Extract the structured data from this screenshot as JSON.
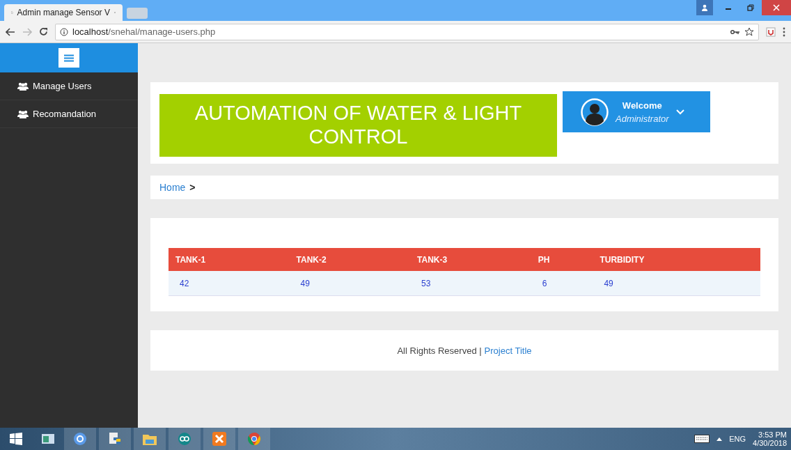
{
  "browser": {
    "tab_title": "Admin manage Sensor V",
    "url_host": "localhost",
    "url_path": "/snehal/manage-users.php"
  },
  "sidebar": {
    "items": [
      {
        "label": "Manage Users"
      },
      {
        "label": "Recomandation"
      }
    ]
  },
  "header": {
    "title": "AUTOMATION OF WATER & LIGHT CONTROL",
    "welcome": "Welcome",
    "role": "Administrator"
  },
  "breadcrumb": {
    "home": "Home",
    "separator": ">"
  },
  "table": {
    "columns": [
      "TANK-1",
      "TANK-2",
      "TANK-3",
      "PH",
      "TURBIDITY"
    ],
    "rows": [
      [
        "42",
        "49",
        "53",
        "6",
        "49"
      ]
    ]
  },
  "footer": {
    "text": "All Rights Reserved |",
    "link": "Project Title"
  },
  "taskbar": {
    "language": "ENG",
    "time": "3:53 PM",
    "date": "4/30/2018"
  }
}
